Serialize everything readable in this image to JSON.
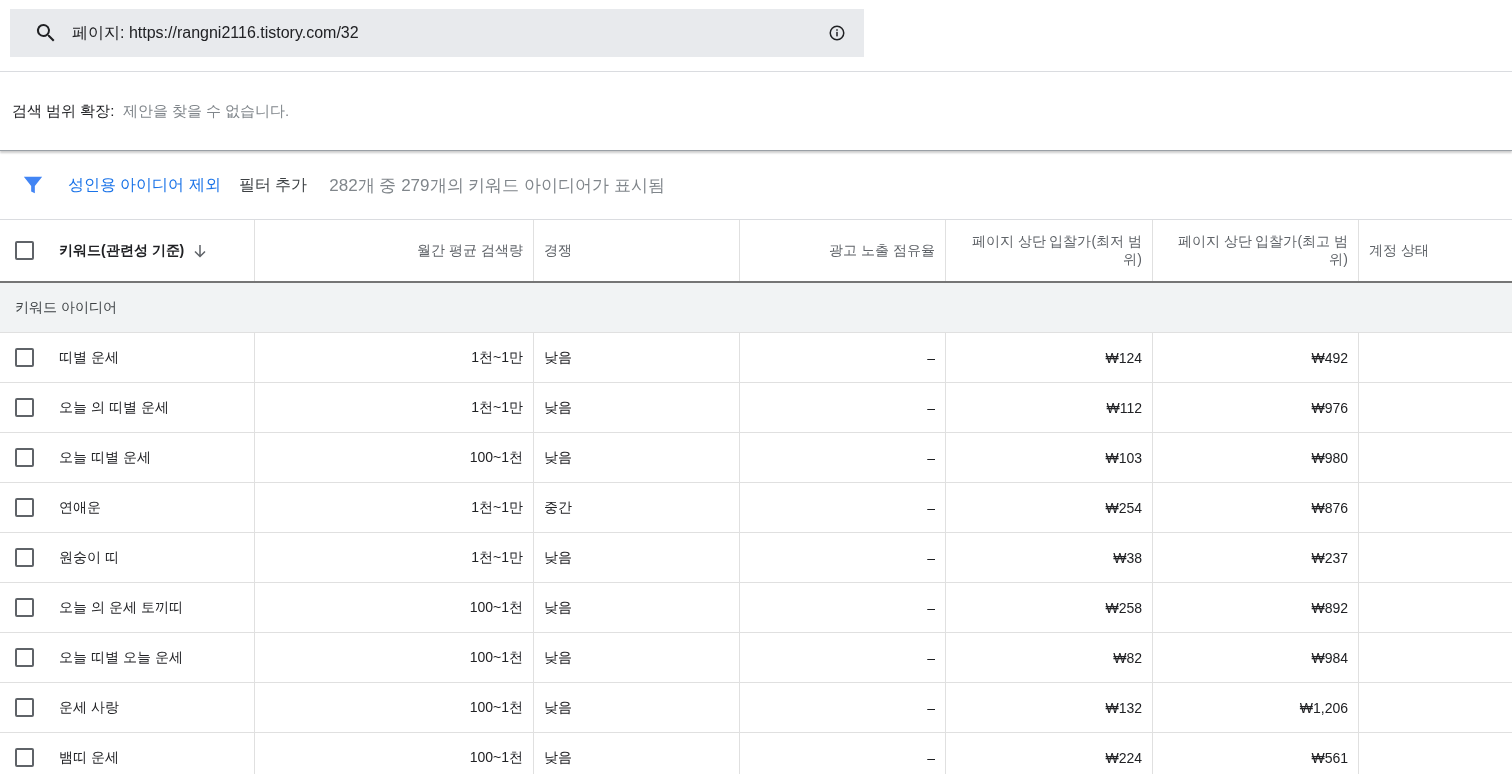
{
  "search": {
    "value": "페이지: https://rangni2116.tistory.com/32"
  },
  "expand": {
    "label": "검색 범위 확장:",
    "message": "제안을 찾을 수 없습니다."
  },
  "filters": {
    "chips": [
      "성인용 아이디어 제외",
      "필터 추가"
    ],
    "summary": "282개 중 279개의 키워드 아이디어가 표시됨"
  },
  "table": {
    "header_checked": false,
    "columns": [
      "키워드(관련성 기준)",
      "월간 평균 검색량",
      "경쟁",
      "광고 노출 점유율",
      "페이지 상단 입찰가(최저 범위)",
      "페이지 상단 입찰가(최고 범위)",
      "계정 상태"
    ],
    "group": "키워드 아이디어",
    "rows": [
      {
        "checked": false,
        "cells": [
          "띠별 운세",
          "1천~1만",
          "낮음",
          "–",
          "₩124",
          "₩492"
        ]
      },
      {
        "checked": false,
        "cells": [
          "오늘 의 띠별 운세",
          "1천~1만",
          "낮음",
          "–",
          "₩112",
          "₩976"
        ]
      },
      {
        "checked": false,
        "cells": [
          "오늘 띠별 운세",
          "100~1천",
          "낮음",
          "–",
          "₩103",
          "₩980"
        ]
      },
      {
        "checked": false,
        "cells": [
          "연애운",
          "1천~1만",
          "중간",
          "–",
          "₩254",
          "₩876"
        ]
      },
      {
        "checked": false,
        "cells": [
          "원숭이 띠",
          "1천~1만",
          "낮음",
          "–",
          "₩38",
          "₩237"
        ]
      },
      {
        "checked": false,
        "cells": [
          "오늘 의 운세 토끼띠",
          "100~1천",
          "낮음",
          "–",
          "₩258",
          "₩892"
        ]
      },
      {
        "checked": false,
        "cells": [
          "오늘 띠별 오늘 운세",
          "100~1천",
          "낮음",
          "–",
          "₩82",
          "₩984"
        ]
      },
      {
        "checked": false,
        "cells": [
          "운세 사랑",
          "100~1천",
          "낮음",
          "–",
          "₩132",
          "₩1,206"
        ]
      },
      {
        "checked": false,
        "cells": [
          "뱀띠 운세",
          "100~1천",
          "낮음",
          "–",
          "₩224",
          "₩561"
        ]
      }
    ]
  }
}
